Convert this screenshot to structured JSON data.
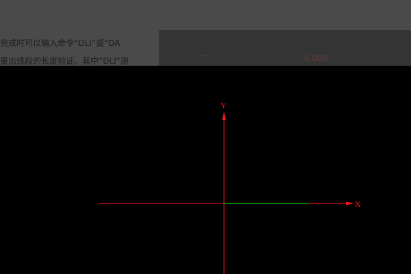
{
  "document": {
    "line1": "完成时可以输入命令“DLI”或“DA",
    "line2": "量出线段的长度验证。其中“DLI”测"
  },
  "overlay": {
    "value_text": "… 0.000"
  },
  "drawing": {
    "y_axis_label": "Y",
    "x_axis_label": "X",
    "axis_color": "#ff1a1a",
    "segment_color": "#00aa00"
  }
}
